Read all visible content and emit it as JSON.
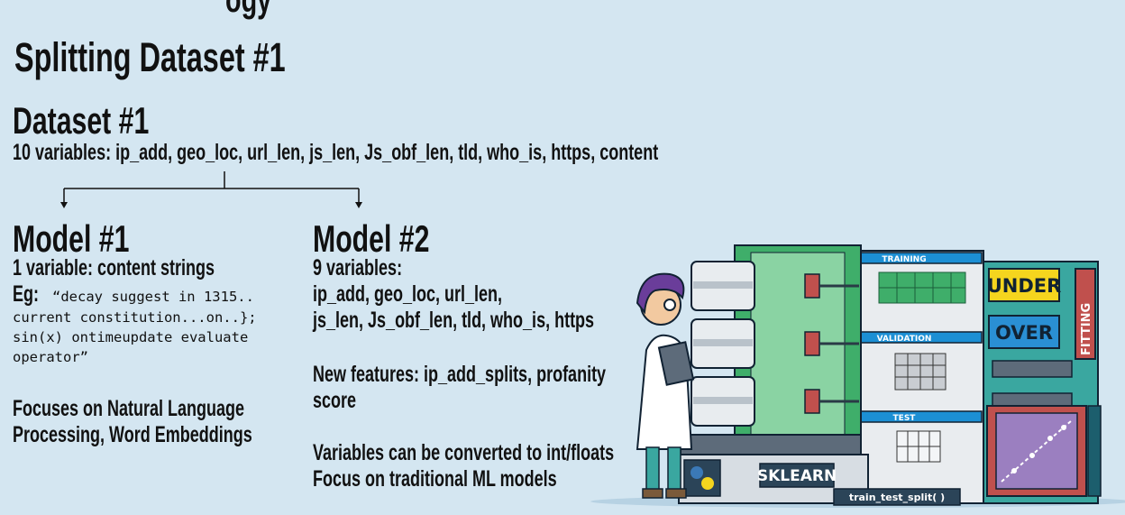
{
  "slide": {
    "top_cut_text": "ogy",
    "title": "Splitting Dataset #1"
  },
  "dataset": {
    "heading": "Dataset #1",
    "variables_line": "10 variables: ip_add, geo_loc, url_len, js_len, Js_obf_len, tld, who_is, https, content"
  },
  "model1": {
    "heading": "Model #1",
    "variables": "1 variable: content strings",
    "eg_label": "Eg:",
    "example_lines": [
      "“decay suggest in 1315..",
      "current constitution...on..};",
      "sin(x) ontimeupdate evaluate",
      "operator”"
    ],
    "focus_lines": [
      "Focuses on Natural Language",
      "Processing, Word Embeddings"
    ]
  },
  "model2": {
    "heading": "Model #2",
    "variables": "9 variables:",
    "variable_list_lines": [
      "ip_add, geo_loc, url_len,",
      "js_len, Js_obf_len, tld, who_is, https"
    ],
    "new_features_lines": [
      "New features: ip_add_splits, profanity",
      "score"
    ],
    "conversion_lines": [
      "Variables can be converted to int/floats",
      "Focus on traditional ML models"
    ]
  },
  "illustration": {
    "training_label": "TRAINING",
    "validation_label": "VALIDATION",
    "test_label": "TEST",
    "under_label": "UNDER",
    "over_label": "OVER",
    "fitting_label": "FITTING",
    "sklearn_label": "SKLEARN",
    "function_label": "train_test_split( )"
  },
  "colors": {
    "background": "#d4e6f1",
    "green_tile": "#3fae6a",
    "blue_tab": "#1c8fd4",
    "yellow": "#f5d51e",
    "red_frame": "#c0504d"
  }
}
